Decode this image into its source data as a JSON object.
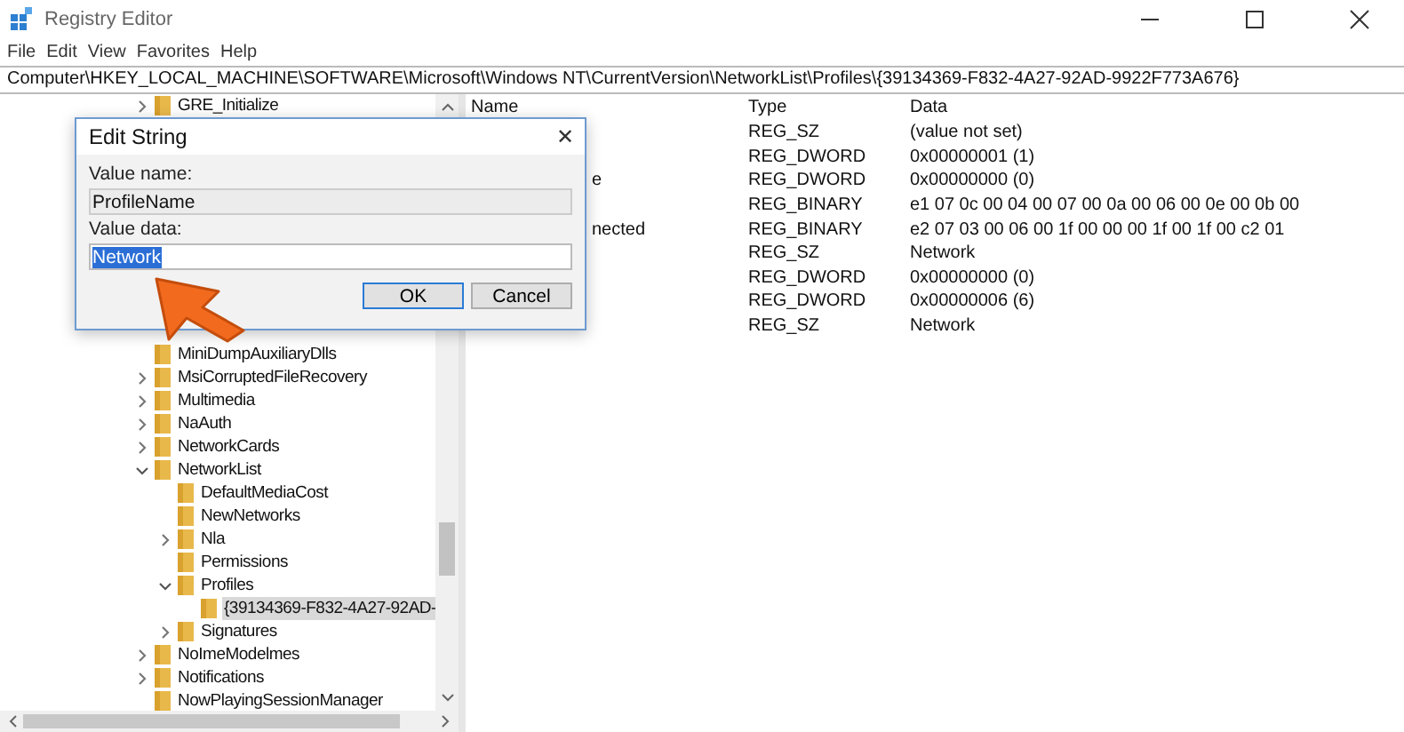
{
  "window": {
    "title": "Registry Editor"
  },
  "menu": [
    "File",
    "Edit",
    "View",
    "Favorites",
    "Help"
  ],
  "address": "Computer\\HKEY_LOCAL_MACHINE\\SOFTWARE\\Microsoft\\Windows NT\\CurrentVersion\\NetworkList\\Profiles\\{39134369-F832-4A27-92AD-9922F773A676}",
  "tree": {
    "items_top": [
      {
        "label": "GRE_Initialize",
        "expanded": false,
        "selected": false
      }
    ],
    "items": [
      {
        "label": "MiniDumpAuxiliaryDlls",
        "selected": false
      },
      {
        "label": "MsiCorruptedFileRecovery",
        "expanded": false,
        "selected": false
      },
      {
        "label": "Multimedia",
        "expanded": false,
        "selected": false
      },
      {
        "label": "NaAuth",
        "expanded": false,
        "selected": false
      },
      {
        "label": "NetworkCards",
        "expanded": false,
        "selected": false
      },
      {
        "label": "NetworkList",
        "expanded": true,
        "selected": false,
        "children": [
          {
            "label": "DefaultMediaCost",
            "selected": false
          },
          {
            "label": "NewNetworks",
            "selected": false
          },
          {
            "label": "Nla",
            "expanded": false,
            "selected": false
          },
          {
            "label": "Permissions",
            "selected": false
          },
          {
            "label": "Profiles",
            "expanded": true,
            "selected": false,
            "children": [
              {
                "label": "{39134369-F832-4A27-92AD-",
                "selected": true
              }
            ]
          },
          {
            "label": "Signatures",
            "expanded": false,
            "selected": false
          }
        ]
      },
      {
        "label": "NoImeModelmes",
        "expanded": false,
        "selected": false
      },
      {
        "label": "Notifications",
        "expanded": false,
        "selected": false
      },
      {
        "label": "NowPlayingSessionManager",
        "selected": false
      }
    ]
  },
  "values": {
    "columns": [
      "Name",
      "Type",
      "Data"
    ],
    "rows": [
      {
        "type": "REG_SZ",
        "data": "(value not set)"
      },
      {
        "type": "REG_DWORD",
        "data": "0x00000001 (1)"
      },
      {
        "name": "e",
        "type": "REG_DWORD",
        "data": "0x00000000 (0)"
      },
      {
        "type": "REG_BINARY",
        "data": "e1 07 0c 00 04 00 07 00 0a 00 06 00 0e 00 0b 00"
      },
      {
        "name": "nected",
        "type": "REG_BINARY",
        "data": "e2 07 03 00 06 00 1f 00 00 00 1f 00 1f 00 c2 01"
      },
      {
        "type": "REG_SZ",
        "data": "Network"
      },
      {
        "type": "REG_DWORD",
        "data": "0x00000000 (0)"
      },
      {
        "type": "REG_DWORD",
        "data": "0x00000006 (6)"
      },
      {
        "type": "REG_SZ",
        "data": "Network"
      }
    ]
  },
  "dialog": {
    "title": "Edit String",
    "close": "✕",
    "fields": [
      {
        "label": "Value name:",
        "value": "ProfileName",
        "disabled": true,
        "selected": false
      },
      {
        "label": "Value data:",
        "value": "Network",
        "disabled": false,
        "selected": true
      }
    ],
    "buttons": [
      {
        "label": "OK",
        "default": true
      },
      {
        "label": "Cancel",
        "default": false
      }
    ]
  }
}
